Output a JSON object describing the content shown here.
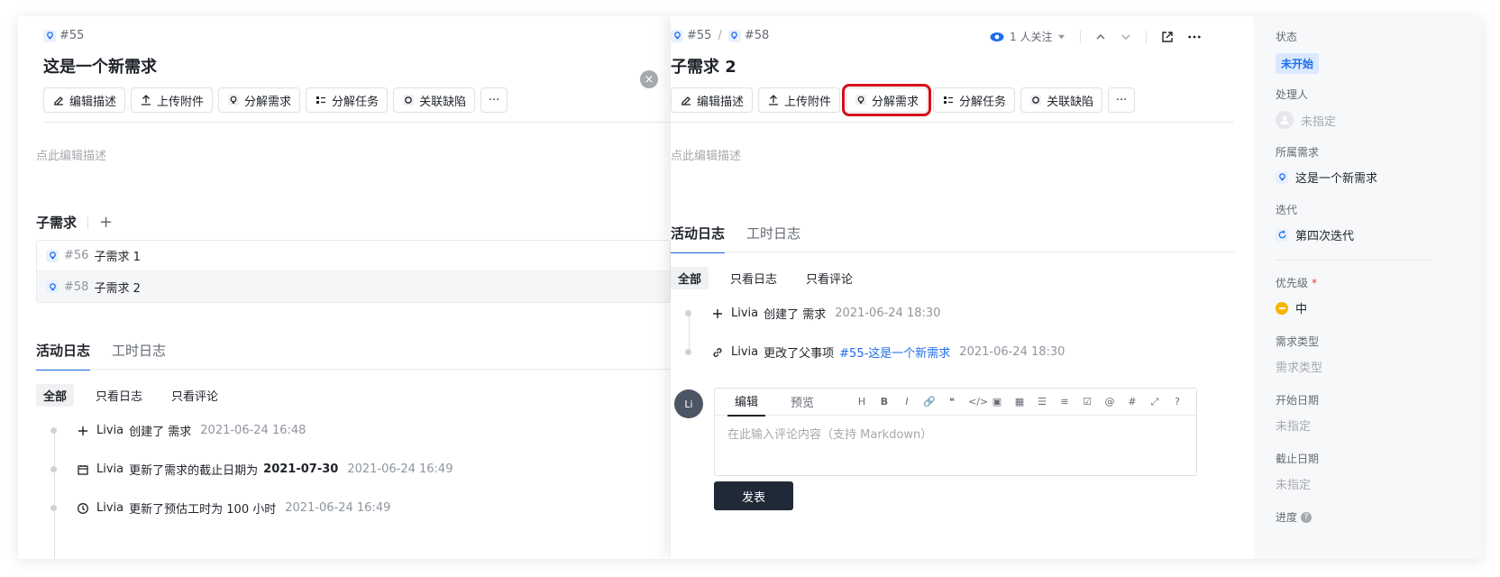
{
  "left": {
    "crumb": "#55",
    "title": "这是一个新需求",
    "toolbar": {
      "edit": "编辑描述",
      "upload": "上传附件",
      "split_req": "分解需求",
      "split_task": "分解任务",
      "link_bug": "关联缺陷",
      "more": "···"
    },
    "placeholder": "点此编辑描述",
    "sub_title": "子需求",
    "sub_add": "+",
    "subs": [
      {
        "num": "#56",
        "name": "子需求 1"
      },
      {
        "num": "#58",
        "name": "子需求 2"
      }
    ],
    "tabs": [
      "活动日志",
      "工时日志"
    ],
    "filters": [
      "全部",
      "只看日志",
      "只看评论"
    ],
    "activity": [
      {
        "actor": "Livia",
        "text": "创建了 需求",
        "time": "2021-06-24 16:48"
      },
      {
        "actor": "Livia",
        "text": "更新了需求的截止日期为",
        "bold": "2021-07-30",
        "time": "2021-06-24 16:49"
      },
      {
        "actor": "Livia",
        "text": "更新了预估工时为 100 小时",
        "time": "2021-06-24 16:49"
      }
    ]
  },
  "close": "×",
  "right": {
    "crumb1": "#55",
    "crumb_sep": "/",
    "crumb2": "#58",
    "watch": "1 人关注",
    "title": "子需求 2",
    "toolbar": {
      "edit": "编辑描述",
      "upload": "上传附件",
      "split_req": "分解需求",
      "split_task": "分解任务",
      "link_bug": "关联缺陷",
      "more": "···"
    },
    "placeholder": "点此编辑描述",
    "tabs": [
      "活动日志",
      "工时日志"
    ],
    "filters": [
      "全部",
      "只看日志",
      "只看评论"
    ],
    "activity": [
      {
        "actor": "Livia",
        "text": "创建了 需求",
        "time": "2021-06-24 18:30"
      },
      {
        "actor": "Livia",
        "text": "更改了父事项",
        "link": "#55-这是一个新需求",
        "time": "2021-06-24 18:30"
      }
    ],
    "comment": {
      "avatar": "Li",
      "tab_edit": "编辑",
      "tab_preview": "预览",
      "tools": [
        "H",
        "B",
        "I",
        "🔗",
        "❝",
        "</>",
        "▣",
        "▦",
        "☰",
        "≡",
        "☑",
        "@",
        "#",
        "⤢",
        "?"
      ],
      "placeholder": "在此输入评论内容（支持 Markdown）",
      "publish": "发表"
    }
  },
  "sidebar": {
    "status_label": "状态",
    "status_value": "未开始",
    "assignee_label": "处理人",
    "assignee_value": "未指定",
    "parent_label": "所属需求",
    "parent_value": "这是一个新需求",
    "iteration_label": "迭代",
    "iteration_value": "第四次迭代",
    "priority_label": "优先级",
    "priority_star": "*",
    "priority_value": "中",
    "type_label": "需求类型",
    "type_value": "需求类型",
    "start_label": "开始日期",
    "start_value": "未指定",
    "due_label": "截止日期",
    "due_value": "未指定",
    "progress_label": "进度",
    "progress_help": "?"
  },
  "colors": {
    "accent": "#1f6eea",
    "highlight": "#d40f1a",
    "priority": "#f5b400"
  }
}
